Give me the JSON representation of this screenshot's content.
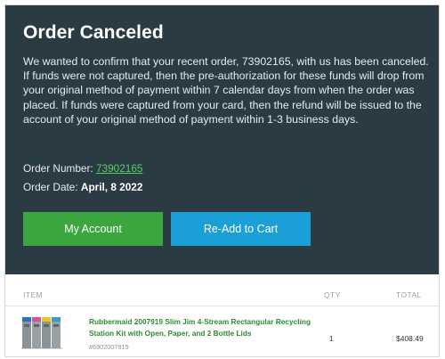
{
  "header": {
    "title": "Order Canceled",
    "message": "We wanted to confirm that your recent order, 73902165, with us has been canceled. If funds were not captured, then the pre-authorization for these funds will drop from your original method of payment within 7 calendar days from when the order was placed. If funds were captured from your card, then the refund will be issued to the account of your original method of payment within 1-3 business days."
  },
  "order": {
    "number_label": "Order Number:",
    "number": "73902165",
    "date_label": "Order Date:",
    "date": "April, 8 2022"
  },
  "buttons": {
    "my_account": "My Account",
    "readd_to_cart": "Re-Add to Cart"
  },
  "colors": {
    "hero_background": "#2b3b44",
    "my_account_button": "#3ba63f",
    "readd_button": "#1a9fd7",
    "link_green": "#57d061"
  },
  "table": {
    "columns": [
      "ITEM",
      "QTY",
      "TOTAL"
    ],
    "rows": [
      {
        "name": "Rubbermaid 2007919 Slim Jim 4-Stream Rectangular Recycling Station Kit with Open, Paper, and 2 Bottle Lids",
        "sku": "#6902007919",
        "qty": "1",
        "total": "$408.49",
        "image": "recycling-station-icon"
      }
    ]
  }
}
